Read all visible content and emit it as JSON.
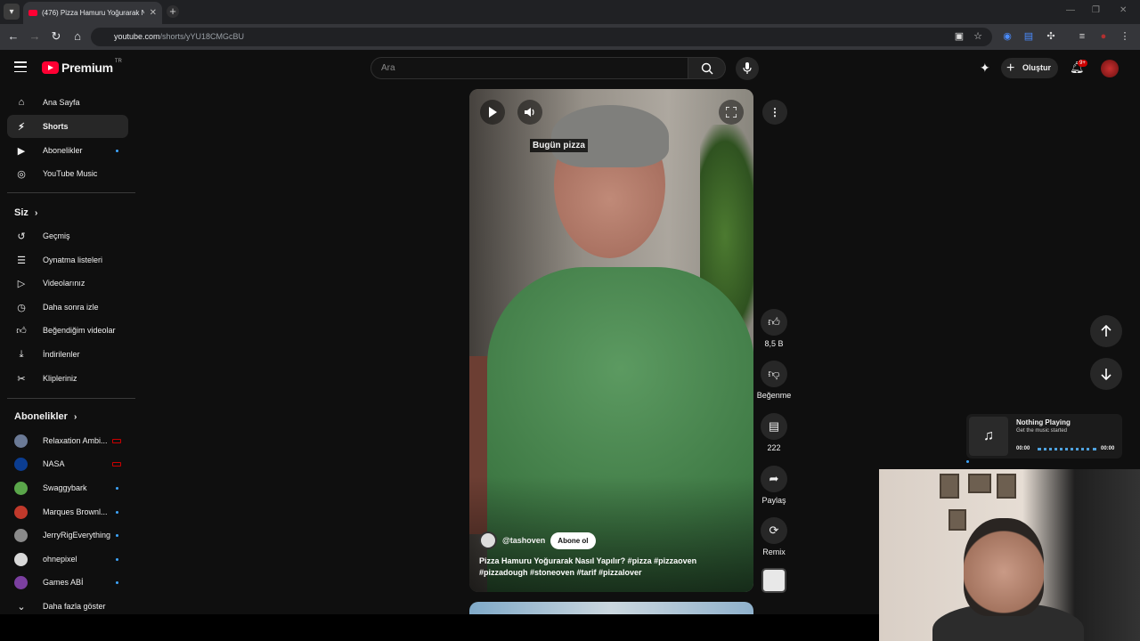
{
  "browser": {
    "tab_title": "(476) Pizza Hamuru Yoğurarak N",
    "url_host": "youtube.com",
    "url_path": "/shorts/yYU18CMGcBU"
  },
  "header": {
    "logo_text": "Premium",
    "country_code": "TR",
    "search_placeholder": "Ara",
    "create_label": "Oluştur",
    "notif_count": "9+"
  },
  "sidebar": {
    "main_items": [
      {
        "label": "Ana Sayfa",
        "icon": "home-icon"
      },
      {
        "label": "Shorts",
        "icon": "shorts-icon"
      },
      {
        "label": "Abonelikler",
        "icon": "subscriptions-icon"
      },
      {
        "label": "YouTube Music",
        "icon": "youtube-music-icon"
      }
    ],
    "you_heading": "Siz",
    "you_items": [
      {
        "label": "Geçmiş",
        "icon": "history-icon"
      },
      {
        "label": "Oynatma listeleri",
        "icon": "playlists-icon"
      },
      {
        "label": "Videolarınız",
        "icon": "your-videos-icon"
      },
      {
        "label": "Daha sonra izle",
        "icon": "watch-later-icon"
      },
      {
        "label": "Beğendiğim videolar",
        "icon": "liked-videos-icon"
      },
      {
        "label": "İndirilenler",
        "icon": "downloads-icon"
      },
      {
        "label": "Klipleriniz",
        "icon": "clips-icon"
      }
    ],
    "subs_heading": "Abonelikler",
    "subscriptions": [
      {
        "label": "Relaxation Ambi...",
        "color": "#6b7a96"
      },
      {
        "label": "NASA",
        "color": "#0b3d91"
      },
      {
        "label": "Swaggybark",
        "color": "#5aa64a"
      },
      {
        "label": "Marques Brownl...",
        "color": "#c0392b"
      },
      {
        "label": "JerryRigEverything",
        "color": "#8a8a8a"
      },
      {
        "label": "ohnepixel",
        "color": "#d8d8d8"
      },
      {
        "label": "Games ABİ",
        "color": "#7b3fa0"
      }
    ],
    "show_more": "Daha fazla göster"
  },
  "short": {
    "caption_overlay": "Bugün pizza",
    "channel_handle": "@tashoven",
    "subscribe_label": "Abone ol",
    "description_line1": "Pizza Hamuru Yoğurarak Nasıl Yapılır?  #pizza #pizzaoven",
    "description_line2": "#pizzadough  #stoneoven #tarif #pizzalover",
    "likes": "8,5 B",
    "dislike_label": "Beğenme",
    "comments": "222",
    "share_label": "Paylaş",
    "remix_label": "Remix"
  },
  "now_playing": {
    "title": "Nothing Playing",
    "subtitle": "Get the music started",
    "time_current": "00:00",
    "time_total": "00:00"
  }
}
